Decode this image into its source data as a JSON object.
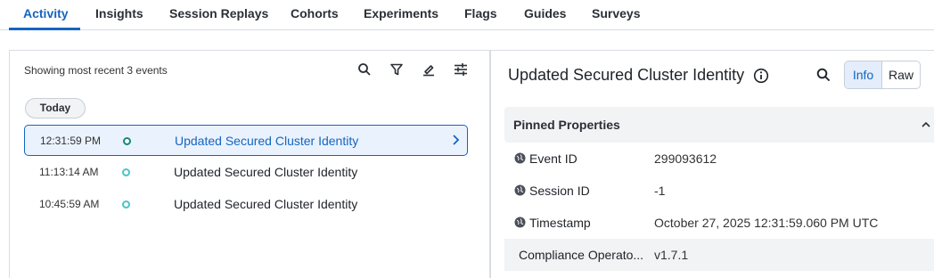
{
  "tabs": [
    {
      "label": "Activity",
      "active": true
    },
    {
      "label": "Insights"
    },
    {
      "label": "Session Replays"
    },
    {
      "label": "Cohorts"
    },
    {
      "label": "Experiments"
    },
    {
      "label": "Flags"
    },
    {
      "label": "Guides"
    },
    {
      "label": "Surveys"
    }
  ],
  "events_panel": {
    "summary": "Showing most recent 3 events",
    "toolbar_icons": [
      "search-icon",
      "filter-icon",
      "highlighter-icon",
      "settings-sliders-icon"
    ],
    "group_label": "Today",
    "events": [
      {
        "time": "12:31:59 PM",
        "name": "Updated Secured Cluster Identity",
        "selected": true
      },
      {
        "time": "11:13:14 AM",
        "name": "Updated Secured Cluster Identity",
        "selected": false
      },
      {
        "time": "10:45:59 AM",
        "name": "Updated Secured Cluster Identity",
        "selected": false
      }
    ]
  },
  "detail_panel": {
    "title": "Updated Secured Cluster Identity",
    "view_toggle": {
      "info": "Info",
      "raw": "Raw",
      "selected": "Info"
    },
    "pinned_section": "Pinned Properties",
    "properties": [
      {
        "key": "Event ID",
        "value": "299093612",
        "icon": "globe-icon"
      },
      {
        "key": "Session ID",
        "value": "-1",
        "icon": "globe-icon"
      },
      {
        "key": "Timestamp",
        "value": "October 27, 2025 12:31:59.060 PM UTC",
        "icon": "globe-icon"
      },
      {
        "key": "Compliance Operato...",
        "value": "v1.7.1"
      }
    ]
  },
  "colors": {
    "accent": "#1565c0",
    "selected_row_bg": "#eaf2fd",
    "dot_selected": "#148a72",
    "dot": "#4cc3c7",
    "section_bg": "#f1f3f5"
  }
}
